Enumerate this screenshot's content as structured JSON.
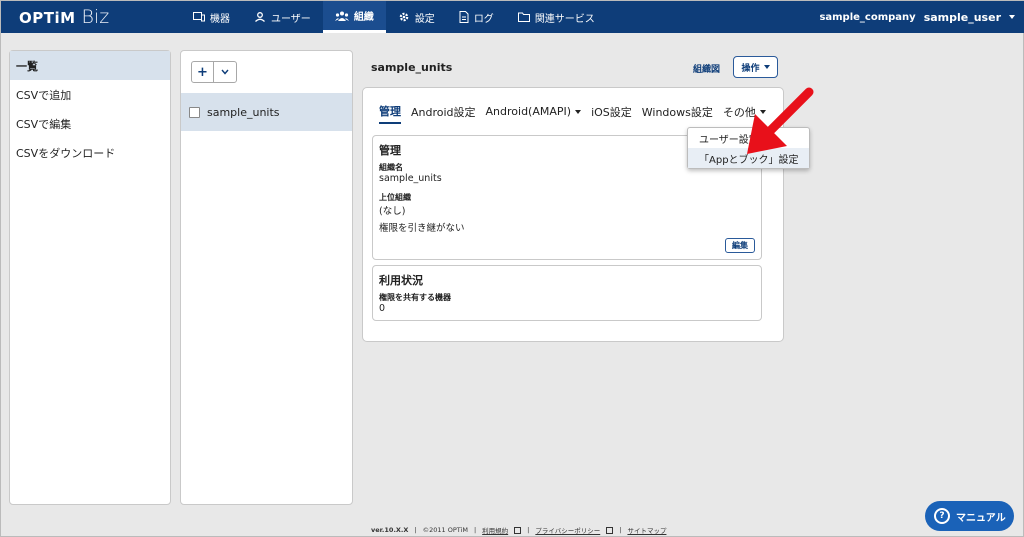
{
  "brand": {
    "optim": "OPTiM",
    "biz": "Biz"
  },
  "nav": [
    {
      "label": "機器",
      "icon": "device-icon"
    },
    {
      "label": "ユーザー",
      "icon": "user-icon"
    },
    {
      "label": "組織",
      "icon": "organization-icon",
      "active": true
    },
    {
      "label": "設定",
      "icon": "gear-icon"
    },
    {
      "label": "ログ",
      "icon": "log-icon"
    },
    {
      "label": "関連サービス",
      "icon": "folder-icon"
    }
  ],
  "user": {
    "company": "sample_company",
    "name": "sample_user"
  },
  "sidebar": {
    "items": [
      {
        "label": "一覧"
      },
      {
        "label": "CSVで追加"
      },
      {
        "label": "CSVで編集"
      },
      {
        "label": "CSVをダウンロード"
      }
    ]
  },
  "list": {
    "add_label": "+",
    "row_label": "sample_units"
  },
  "main": {
    "title": "sample_units",
    "org_chart_link": "組織図",
    "operation_label": "操作",
    "tabs": [
      {
        "label": "管理"
      },
      {
        "label": "Android設定"
      },
      {
        "label": "Android(AMAPI)"
      },
      {
        "label": "iOS設定"
      },
      {
        "label": "Windows設定"
      },
      {
        "label": "その他"
      }
    ],
    "manage": {
      "title": "管理",
      "org_name_label": "組織名",
      "org_name_value": "sample_units",
      "parent_label": "上位組織",
      "parent_value": "(なし)",
      "inherit_text": "権限を引き継がない",
      "edit_label": "編集"
    },
    "usage": {
      "title": "利用状況",
      "shared_label": "権限を共有する機器",
      "shared_value": "0"
    },
    "dropdown": [
      {
        "label": "ユーザー設定"
      },
      {
        "label": "「Appとブック」設定"
      }
    ]
  },
  "footer": {
    "version": "ver.10.X.X",
    "copyright": "©2011 OPTiM",
    "terms": "利用規約",
    "privacy": "プライバシーポリシー",
    "sitemap": "サイトマップ"
  },
  "manual": {
    "label": "マニュアル"
  },
  "colors": {
    "nav_bg": "#0e3d79",
    "accent": "#1a62b8",
    "arrow": "#e8101a"
  }
}
